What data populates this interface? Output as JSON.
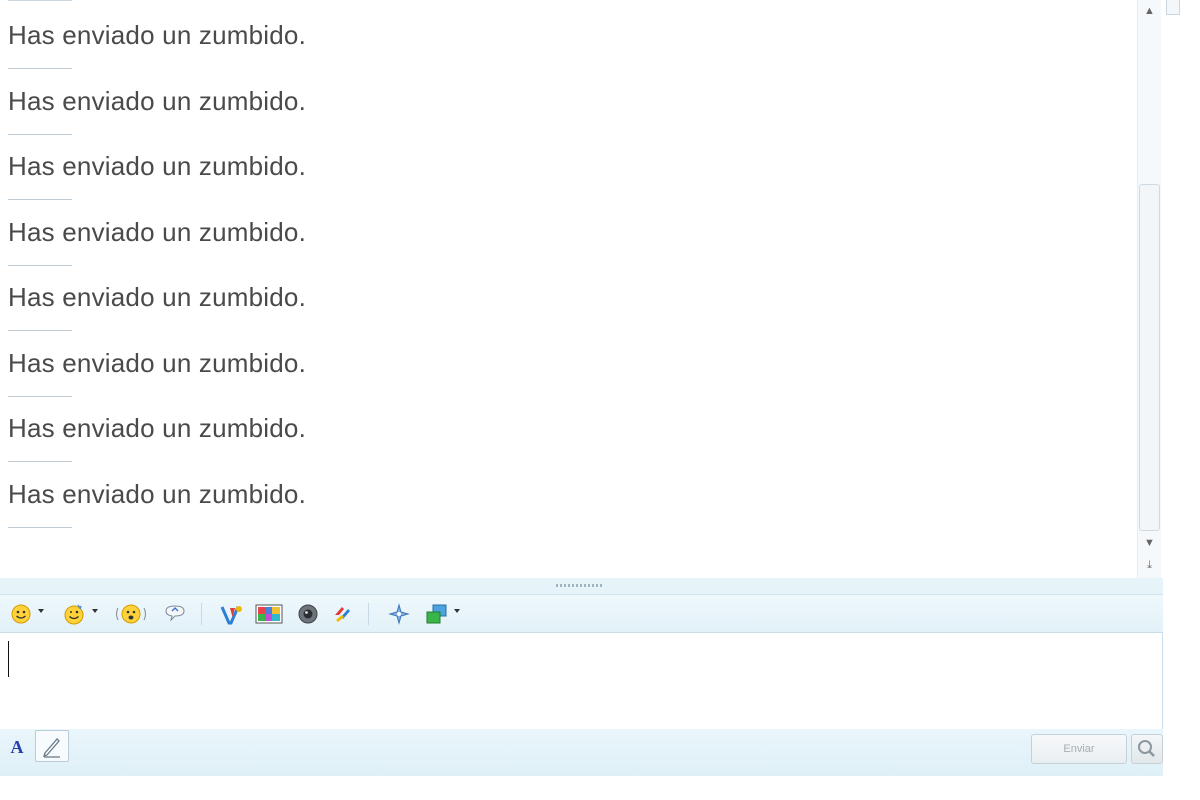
{
  "conversation": {
    "messages": [
      "Has enviado un zumbido.",
      "Has enviado un zumbido.",
      "Has enviado un zumbido.",
      "Has enviado un zumbido.",
      "Has enviado un zumbido.",
      "Has enviado un zumbido.",
      "Has enviado un zumbido.",
      "Has enviado un zumbido."
    ]
  },
  "input": {
    "value": ""
  },
  "bottom_bar": {
    "font_label": "A",
    "send_label": "Enviar"
  },
  "toolbar": {
    "icons": [
      "emoticon-icon",
      "wink-icon",
      "nudge-icon",
      "voice-clip-icon",
      "games-icon",
      "backgrounds-icon",
      "webcam-icon",
      "share-icon",
      "activities-icon",
      "send-file-icon"
    ]
  },
  "colors": {
    "message_text": "#4a4a4a",
    "toolbar_bg": "#e2f1f8",
    "accent": "#2540a8"
  }
}
